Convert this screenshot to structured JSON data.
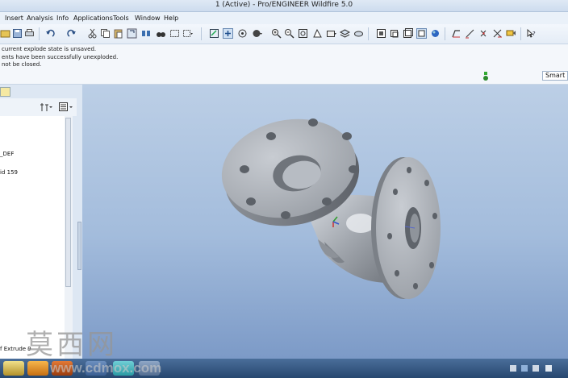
{
  "window": {
    "title": "1 (Active) - Pro/ENGINEER Wildfire 5.0"
  },
  "menu": [
    "Insert",
    "Analysis",
    "Info",
    "Applications",
    "Tools",
    "Window",
    "Help"
  ],
  "messages": [
    "current explode state is unsaved.",
    "ents have been successfully unexploded.",
    "not be closed."
  ],
  "filter": {
    "value": "Smart"
  },
  "model_tree": {
    "items": [
      "_DEF",
      "id 159",
      "f Extrude 9"
    ]
  },
  "watermark": {
    "chars": [
      "莫",
      "西",
      "网"
    ],
    "url": "www.cdmox.com"
  },
  "colors": {
    "accent": "#2f6fb5",
    "viewport_top": "#bccfe6",
    "viewport_bottom": "#7c9ac7"
  }
}
